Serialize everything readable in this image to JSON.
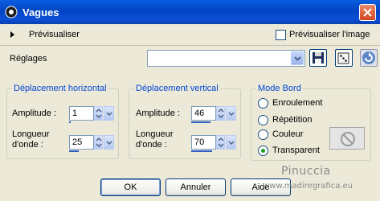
{
  "window": {
    "title": "Vagues"
  },
  "preview": {
    "label": "Prévisualiser",
    "image_checkbox_label": "Prévisualiser l'image",
    "image_checked": false
  },
  "settings": {
    "label": "Réglages",
    "combo_value": ""
  },
  "horizontal": {
    "title": "Déplacement horizontal",
    "amplitude_label": "Amplitude :",
    "amplitude_value": "1",
    "wavelength_label_1": "Longueur",
    "wavelength_label_2": "d'onde :",
    "wavelength_value": "25"
  },
  "vertical": {
    "title": "Déplacement vertical",
    "amplitude_label": "Amplitude :",
    "amplitude_value": "46",
    "wavelength_label_1": "Longueur",
    "wavelength_label_2": "d'onde :",
    "wavelength_value": "70"
  },
  "edge_mode": {
    "title": "Mode Bord",
    "options": [
      "Enroulement",
      "Répétition",
      "Couleur",
      "Transparent"
    ],
    "selected": "Transparent"
  },
  "buttons": {
    "ok": "OK",
    "cancel": "Annuler",
    "help": "Aide"
  },
  "watermark": {
    "line1": "Pinuccia",
    "line2": "www.madiregrafica.eu"
  },
  "colors": {
    "titlebar": "#0a5fe0",
    "group_title": "#0046d5",
    "dialog_bg": "#ece9d8"
  }
}
